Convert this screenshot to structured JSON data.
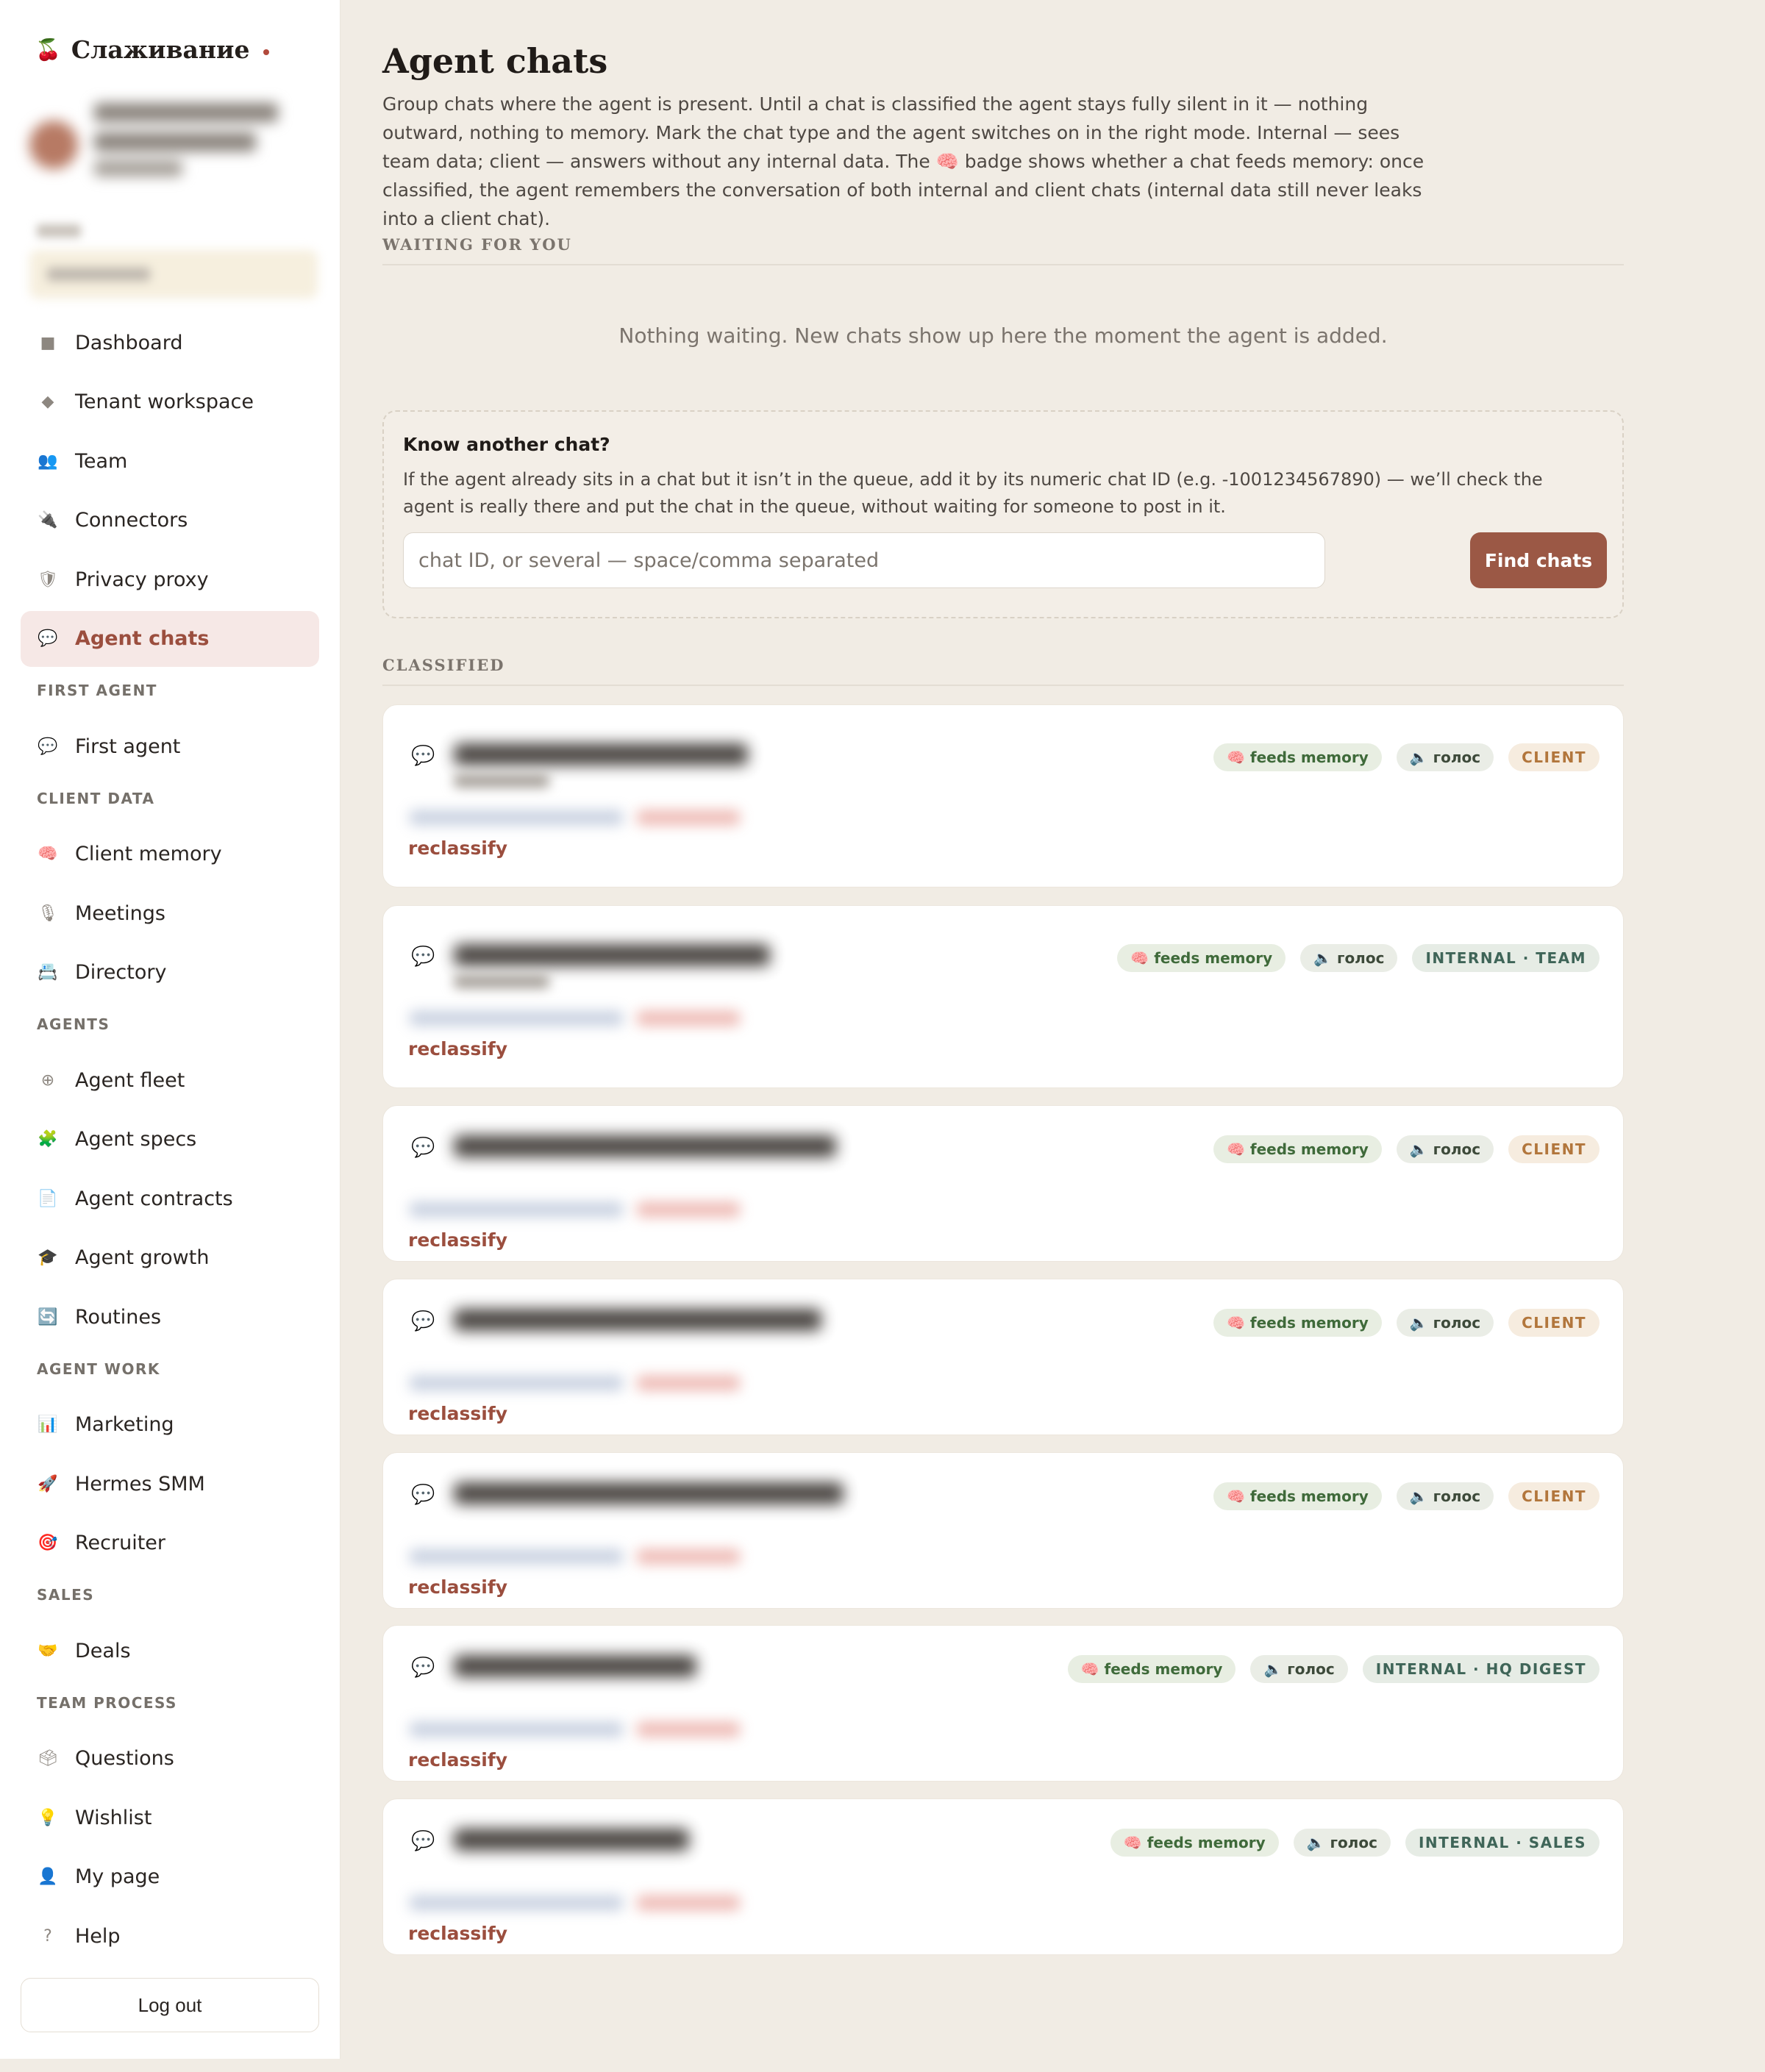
{
  "app": {
    "name": "Слаживание",
    "logo_icon": "🍒"
  },
  "sidebar": {
    "items_top": [
      {
        "label": "Dashboard",
        "icon": "■"
      },
      {
        "label": "Tenant workspace",
        "icon": "◆"
      },
      {
        "label": "Team",
        "icon": "👥"
      },
      {
        "label": "Connectors",
        "icon": "🔌"
      },
      {
        "label": "Privacy proxy",
        "icon": "🛡"
      },
      {
        "label": "Agent chats",
        "icon": "💬"
      }
    ],
    "sections": [
      {
        "title": "FIRST AGENT",
        "items": [
          {
            "label": "First agent",
            "icon": "💬"
          }
        ]
      },
      {
        "title": "CLIENT DATA",
        "items": [
          {
            "label": "Client memory",
            "icon": "🧠"
          },
          {
            "label": "Meetings",
            "icon": "🎙"
          },
          {
            "label": "Directory",
            "icon": "📇"
          }
        ]
      },
      {
        "title": "AGENTS",
        "items": [
          {
            "label": "Agent fleet",
            "icon": "⊕"
          },
          {
            "label": "Agent specs",
            "icon": "🧩"
          },
          {
            "label": "Agent contracts",
            "icon": "📄"
          },
          {
            "label": "Agent growth",
            "icon": "🎓"
          },
          {
            "label": "Routines",
            "icon": "🔄"
          }
        ]
      },
      {
        "title": "AGENT WORK",
        "items": [
          {
            "label": "Marketing",
            "icon": "📊"
          },
          {
            "label": "Hermes SMM",
            "icon": "🚀"
          },
          {
            "label": "Recruiter",
            "icon": "🎯"
          }
        ]
      },
      {
        "title": "SALES",
        "items": [
          {
            "label": "Deals",
            "icon": "🤝"
          }
        ]
      },
      {
        "title": "TEAM PROCESS",
        "items": [
          {
            "label": "Questions",
            "icon": "🗳"
          },
          {
            "label": "Wishlist",
            "icon": "💡"
          },
          {
            "label": "My page",
            "icon": "👤"
          },
          {
            "label": "Help",
            "icon": "?"
          }
        ]
      }
    ],
    "logout_label": "Log out"
  },
  "main": {
    "title": "Agent chats",
    "intro": "Group chats where the agent is present. Until a chat is classified the agent stays fully silent in it — nothing outward, nothing to memory. Mark the chat type and the agent switches on in the right mode. Internal — sees team data; client — answers without any internal data. The 🧠 badge shows whether a chat feeds memory: once classified, the agent remembers the conversation of both internal and client chats (internal data still never leaks into a client chat).",
    "waiting_heading": "WAITING FOR YOU",
    "waiting_empty": "Nothing waiting. New chats show up here the moment the agent is added.",
    "know": {
      "heading": "Know another chat?",
      "text": "If the agent already sits in a chat but it isn’t in the queue, add it by its numeric chat ID (e.g. -1001234567890) — we’ll check the agent is really there and put the chat in the queue, without waiting for someone to post in it.",
      "placeholder": "chat ID, or several — space/comma separated",
      "button": "Find chats"
    },
    "classified_heading": "CLASSIFIED",
    "chats": [
      {
        "memory": "🧠 feeds memory",
        "voice": "🔈 голос",
        "type": "CLIENT",
        "kind": "client",
        "reclassify": "reclassify"
      },
      {
        "memory": "🧠 feeds memory",
        "voice": "🔈 голос",
        "type": "INTERNAL · TEAM",
        "kind": "internal",
        "reclassify": "reclassify"
      },
      {
        "memory": "🧠 feeds memory",
        "voice": "🔈 голос",
        "type": "CLIENT",
        "kind": "client",
        "reclassify": "reclassify"
      },
      {
        "memory": "🧠 feeds memory",
        "voice": "🔈 голос",
        "type": "CLIENT",
        "kind": "client",
        "reclassify": "reclassify"
      },
      {
        "memory": "🧠 feeds memory",
        "voice": "🔈 голос",
        "type": "CLIENT",
        "kind": "client",
        "reclassify": "reclassify"
      },
      {
        "memory": "🧠 feeds memory",
        "voice": "🔈 голос",
        "type": "INTERNAL · HQ DIGEST",
        "kind": "internal",
        "reclassify": "reclassify"
      },
      {
        "memory": "🧠 feeds memory",
        "voice": "🔈 голос",
        "type": "INTERNAL · SALES",
        "kind": "internal",
        "reclassify": "reclassify"
      }
    ],
    "chat_icon": "💬"
  },
  "colors": {
    "background": "#f1ece4",
    "accent": "#9b5845",
    "active_nav_bg": "#f6e8e6",
    "memory_badge": "#3f6a3a",
    "client_badge": "#b2763c",
    "internal_badge": "#3f6558"
  }
}
